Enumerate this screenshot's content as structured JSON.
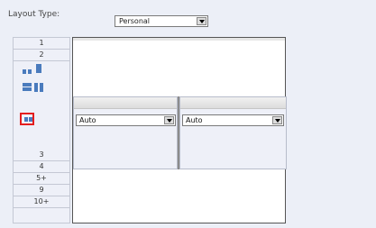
{
  "layout": {
    "label": "Layout Type:",
    "selected": "Personal"
  },
  "left_panel": {
    "top_buttons": [
      "1",
      "2"
    ],
    "bottom_buttons": [
      "3",
      "4",
      "5+",
      "9",
      "10+"
    ],
    "icons": [
      "two-column-icon",
      "one-column-icon",
      "two-rows-icon",
      "split-columns-icon",
      "selected-layout-icon"
    ]
  },
  "panes": [
    {
      "value": "Auto"
    },
    {
      "value": "Auto"
    }
  ],
  "colors": {
    "accent": "#4a7bbd",
    "selected_border": "#e41e1e"
  }
}
